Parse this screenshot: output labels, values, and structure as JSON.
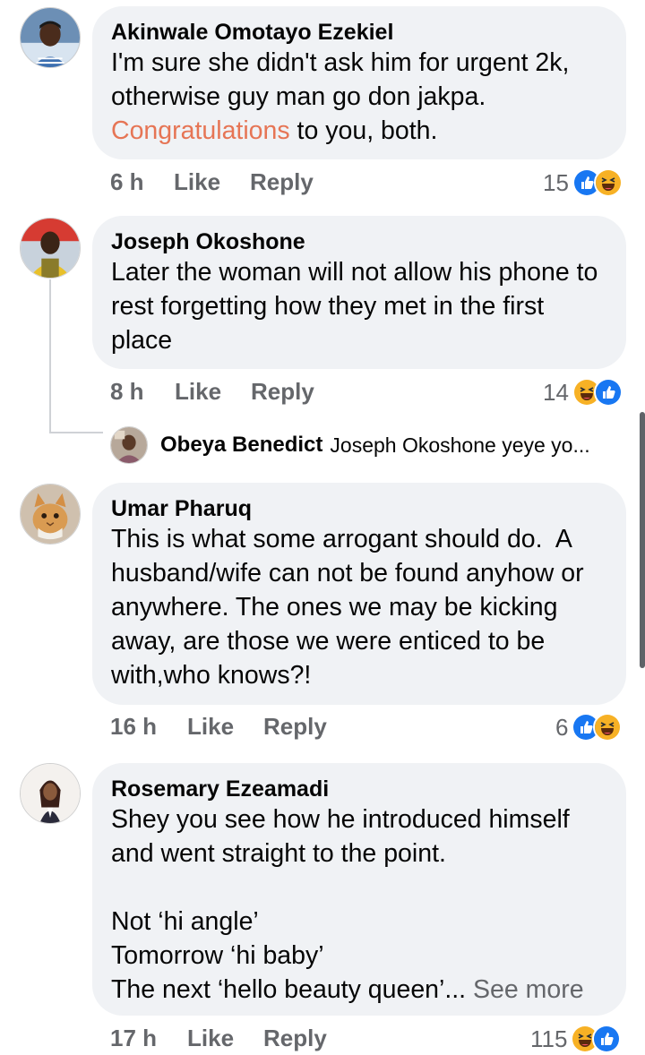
{
  "comments": [
    {
      "author": "Akinwale Omotayo Ezekiel",
      "text_before": "I'm sure she didn't ask him for urgent 2k, otherwise guy man go don jakpa. ",
      "mention": "Congratulations",
      "text_after": " to you, both.",
      "time": "6 h",
      "like_label": "Like",
      "reply_label": "Reply",
      "reaction_count": "15",
      "reactions": [
        "like-icon",
        "haha-icon"
      ]
    },
    {
      "author": "Joseph Okoshone",
      "text": "Later the woman will not allow his phone to rest forgetting how they met in the first place",
      "time": "8 h",
      "like_label": "Like",
      "reply_label": "Reply",
      "reaction_count": "14",
      "reactions": [
        "haha-icon",
        "like-icon"
      ],
      "reply_preview": {
        "author": "Obeya Benedict",
        "text": "Joseph Okoshone yeye yo..."
      }
    },
    {
      "author": "Umar Pharuq",
      "text": "This is what some arrogant should do.  A husband/wife can not be found anyhow or anywhere. The ones we may be kicking away, are those we were enticed to be with,who knows?!",
      "time": "16 h",
      "like_label": "Like",
      "reply_label": "Reply",
      "reaction_count": "6",
      "reactions": [
        "like-icon",
        "haha-icon"
      ]
    },
    {
      "author": "Rosemary Ezeamadi",
      "text": "Shey you see how he introduced himself and went straight to the point.\n\nNot ‘hi angle’\nTomorrow ‘hi baby’\nThe next ‘hello beauty queen’...",
      "see_more": " See more",
      "time": "17 h",
      "like_label": "Like",
      "reply_label": "Reply",
      "reaction_count": "115",
      "reactions": [
        "haha-icon",
        "like-icon"
      ]
    }
  ],
  "colors": {
    "bubble": "#f0f2f5",
    "secondary_text": "#65676b",
    "mention": "#e67555",
    "like_blue": "#1877f2",
    "haha_yellow": "#f7b125"
  }
}
